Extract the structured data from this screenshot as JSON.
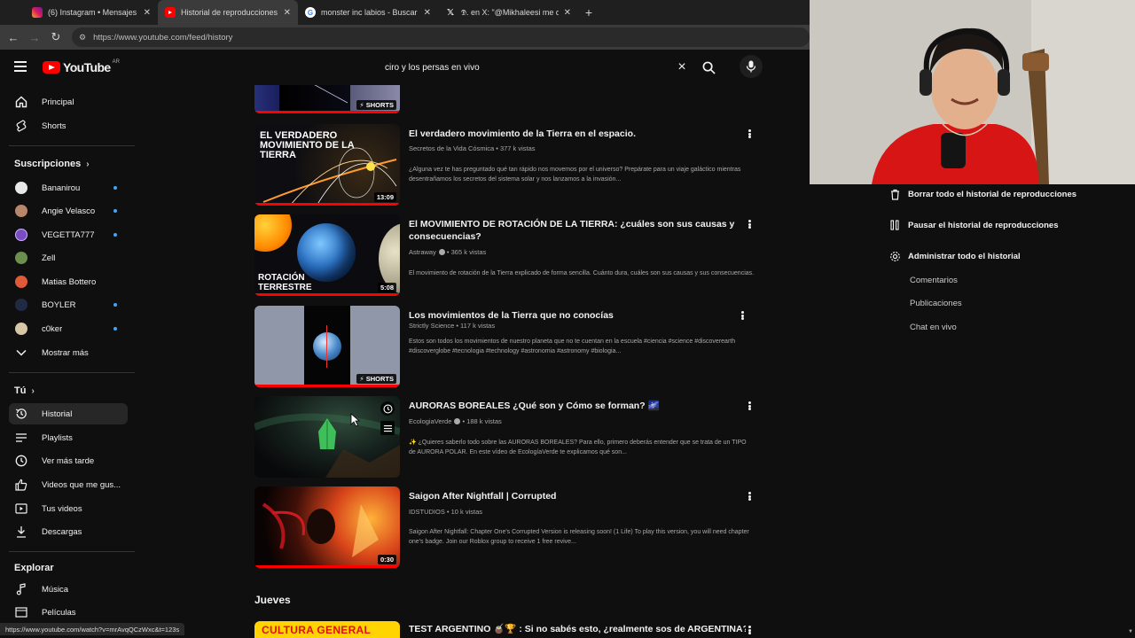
{
  "browser": {
    "tabs": [
      {
        "title": "(6) Instagram • Mensajes",
        "active": false
      },
      {
        "title": "Historial de reproducciones - YouTube",
        "active": true
      },
      {
        "title": "monster inc labios - Buscar con Google",
        "active": false
      },
      {
        "title": "𝕯. en X: \"@Mikhaleesi me da la",
        "active": false
      }
    ],
    "url": "https://www.youtube.com/feed/history",
    "status_url": "https://www.youtube.com/watch?v=mrAvqQCzWxc&t=123s"
  },
  "header": {
    "logo_text": "YouTube",
    "country": "AR",
    "search_query": "ciro y los persas en vivo"
  },
  "sidebar": {
    "main_items": [
      {
        "label": "Principal",
        "icon": "home-icon"
      },
      {
        "label": "Shorts",
        "icon": "shorts-icon"
      }
    ],
    "subs_heading": "Suscripciones",
    "subscriptions": [
      {
        "label": "Bananirou",
        "color": "#e8e8e8",
        "dot": true
      },
      {
        "label": "Angie Velasco",
        "color": "#b8866a",
        "dot": true
      },
      {
        "label": "VEGETTA777",
        "color": "#7a4cc4",
        "dot": true
      },
      {
        "label": "Zell",
        "color": "#6b8f4e",
        "dot": false
      },
      {
        "label": "Matias Bottero",
        "color": "#e05a3a",
        "dot": false
      },
      {
        "label": "BOYLER",
        "color": "#1f2a44",
        "dot": true
      },
      {
        "label": "c0ker",
        "color": "#d8c6a8",
        "dot": true
      }
    ],
    "show_more": "Mostrar más",
    "you_heading": "Tú",
    "you_items": [
      {
        "label": "Historial",
        "icon": "history-icon",
        "selected": true
      },
      {
        "label": "Playlists",
        "icon": "playlist-icon",
        "selected": false
      },
      {
        "label": "Ver más tarde",
        "icon": "clock-icon",
        "selected": false
      },
      {
        "label": "Videos que me gus...",
        "icon": "thumb-up-icon",
        "selected": false
      },
      {
        "label": "Tus videos",
        "icon": "video-icon",
        "selected": false
      },
      {
        "label": "Descargas",
        "icon": "download-icon",
        "selected": false
      }
    ],
    "explore_heading": "Explorar",
    "explore_items": [
      {
        "label": "Música",
        "icon": "music-icon"
      },
      {
        "label": "Películas",
        "icon": "film-icon"
      }
    ]
  },
  "videos": [
    {
      "title": "El verdadero movimiento de la Tierra en el espacio.",
      "meta": "Secretos de la Vida Cósmica • 377 k vistas",
      "desc": "¿Alguna vez te has preguntado qué tan rápido nos movemos por el universo? Prepárate para un viaje galáctico mientras desentrañamos los secretos del sistema solar y nos lanzamos a la invasión...",
      "duration": "13:09",
      "thumb_text": "EL VERDADERO MOVIMIENTO DE LA TIERRA"
    },
    {
      "title": "El MOVIMIENTO DE ROTACIÓN DE LA TIERRA: ¿cuáles son sus causas y consecuencias?",
      "meta": "Astraway",
      "meta_views": " • 365 k vistas",
      "desc": "El movimiento de rotación de la Tierra explicado de forma sencilla. Cuánto dura, cuáles son sus causas y sus consecuencias.",
      "duration": "5:08",
      "thumb_text": "ROTACIÓN TERRESTRE"
    },
    {
      "title": "Los movimientos de la Tierra que no conocías",
      "meta": "Strictly Science • 117 k vistas",
      "desc": "Estos son todos los movimientos de nuestro planeta que no te cuentan en la escuela #ciencia #science #discoverearth #discoverglobe #tecnologia #technology #astronomia #astronomy #biologia...",
      "duration": "SHORTS"
    },
    {
      "title": "AURORAS BOREALES ¿Qué son y Cómo se forman? 🌌",
      "meta": "EcologiaVerde",
      "meta_views": " • 188 k vistas",
      "desc": "✨ ¿Quieres saberlo todo sobre las AURORAS BOREALES? Para ello, primero deberás entender que se trata de un TIPO de AURORA POLAR. En este vídeo de EcologíaVerde te explicamos qué son..."
    },
    {
      "title": "Saigon After Nightfall | Corrupted",
      "meta": "IDSTUDIOS • 10 k vistas",
      "desc": "Saigon After Nightfall: Chapter One's Corrupted Version is releasing soon! (1 Life) To play this version, you will need chapter one's badge. Join our Roblox group to receive 1 free revive...",
      "duration": "0:30"
    }
  ],
  "top_badge": "SHORTS",
  "day_heading": "Jueves",
  "next_video": {
    "title": "TEST ARGENTINO 🧉🏆 : Si no sabés esto, ¿realmente sos de ARGENTINA? |",
    "thumb_text": "CULTURA GENERAL"
  },
  "right_panel": {
    "actions": [
      {
        "label": "Borrar todo el historial de reproducciones",
        "icon": "trash-icon"
      },
      {
        "label": "Pausar el historial de reproducciones",
        "icon": "pause-icon"
      },
      {
        "label": "Administrar todo el historial",
        "icon": "gear-icon"
      }
    ],
    "sub_links": [
      "Comentarios",
      "Publicaciones",
      "Chat en vivo"
    ]
  }
}
